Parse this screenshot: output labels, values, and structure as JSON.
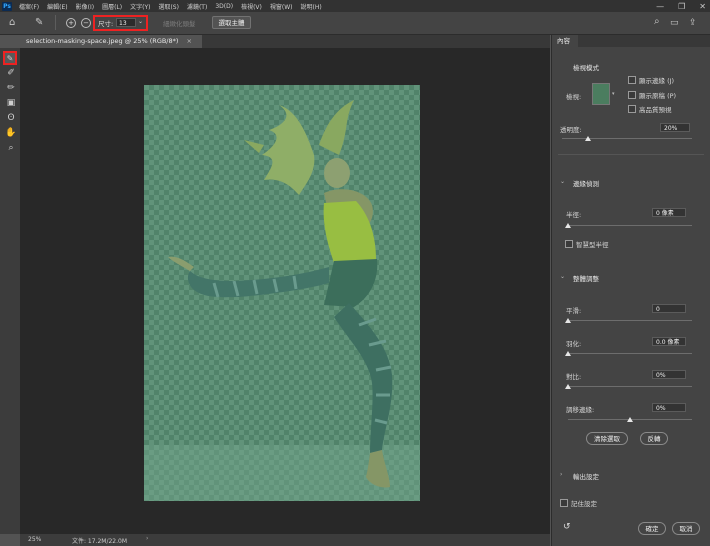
{
  "menubar": {
    "app_badge": "Ps",
    "items": [
      "檔案(F)",
      "編輯(E)",
      "影像(I)",
      "圖層(L)",
      "文字(Y)",
      "選取(S)",
      "濾鏡(T)",
      "3D(D)",
      "檢視(V)",
      "視窗(W)",
      "說明(H)"
    ],
    "win_controls": [
      "—",
      "❐",
      "✕"
    ]
  },
  "options": {
    "size_label": "尺寸:",
    "size_value": "13",
    "refine_hair": "細緻化頭髮",
    "select_subject": "選取主體"
  },
  "document": {
    "tab_title": "selection-masking-space.jpeg @ 25% (RGB/8*)",
    "tab_close": "×"
  },
  "status": {
    "zoom": "25%",
    "doc_size": "文件: 17.2M/22.0M",
    "arrow": "›"
  },
  "panel": {
    "tab": "內容",
    "view_mode_heading": "檢視模式",
    "view_label": "檢視:",
    "show_edge": "顯示邊緣 (J)",
    "show_original": "顯示原稿 (P)",
    "high_quality": "高品質預視",
    "opacity_label": "透明度:",
    "opacity_value": "20%",
    "opacity_pct": 20,
    "edge_detection": "邊緣偵測",
    "radius_label": "半徑:",
    "radius_value": "0 像素",
    "radius_pct": 0,
    "smart_radius": "智慧型半徑",
    "global_refinements": "整體調整",
    "smooth_label": "平滑:",
    "smooth_value": "0",
    "smooth_pct": 0,
    "feather_label": "羽化:",
    "feather_value": "0.0 像素",
    "feather_pct": 0,
    "contrast_label": "對比:",
    "contrast_value": "0%",
    "contrast_pct": 0,
    "shift_edge_label": "調移邊緣:",
    "shift_edge_value": "0%",
    "shift_edge_pct": 50,
    "clear_selection": "清除選取",
    "invert": "反轉",
    "output_settings": "輸出設定",
    "remember_settings": "記住設定",
    "ok": "確定",
    "cancel": "取消"
  }
}
